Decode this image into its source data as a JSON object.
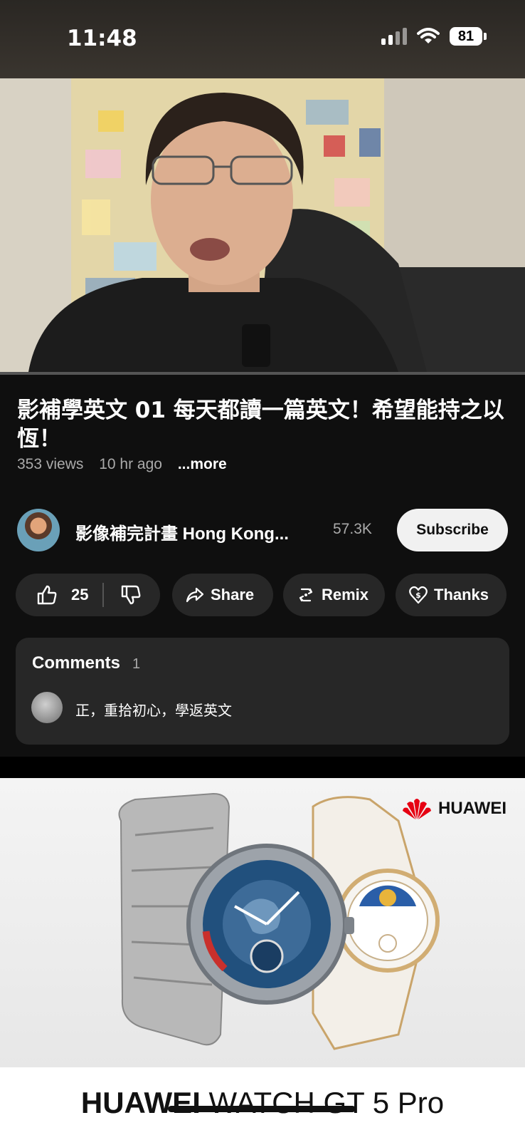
{
  "status": {
    "time": "11:48",
    "battery": "81"
  },
  "video": {
    "progress_fraction": 0.0
  },
  "title": "影補學英文 01 每天都讀一篇英文！希望能持之以恆！",
  "meta": {
    "views": "353 views",
    "age": "10 hr ago",
    "more": "...more"
  },
  "channel": {
    "name": "影像補完計畫 Hong Kong...",
    "subscribers": "57.3K",
    "subscribe_label": "Subscribe"
  },
  "actions": {
    "likes": "25",
    "share": "Share",
    "remix": "Remix",
    "thanks": "Thanks"
  },
  "comments": {
    "title": "Comments",
    "count": "1",
    "first_comment": "正，重拾初心，學返英文"
  },
  "ad": {
    "brand": "HUAWEI",
    "product_brand": "HUAWEI",
    "product_name": "WATCH GT 5 Pro",
    "brand_color": "#e60012"
  },
  "icons": [
    "signal-icon",
    "wifi-icon",
    "battery-icon",
    "thumbs-up-icon",
    "thumbs-down-icon",
    "share-icon",
    "remix-icon",
    "thanks-icon",
    "huawei-logo-icon"
  ]
}
